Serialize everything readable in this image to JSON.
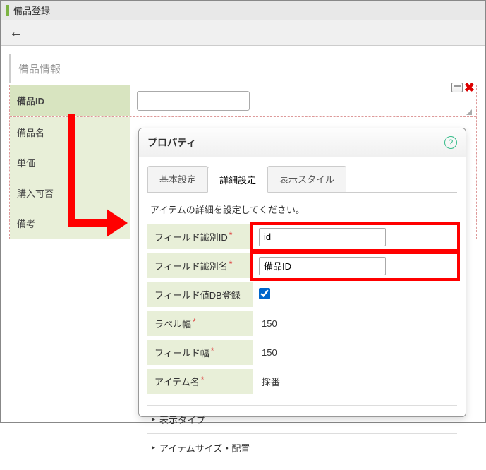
{
  "header": {
    "title": "備品登録"
  },
  "section": {
    "info_label": "備品情報"
  },
  "form": {
    "rows": {
      "id": {
        "label": "備品ID"
      },
      "name": {
        "label": "備品名"
      },
      "price": {
        "label": "単価"
      },
      "purchasable": {
        "label": "購入可否"
      },
      "remarks": {
        "label": "備考"
      }
    }
  },
  "panel": {
    "title": "プロパティ",
    "tabs": {
      "basic": "基本設定",
      "detail": "詳細設定",
      "style": "表示スタイル"
    },
    "description": "アイテムの詳細を設定してください。",
    "props": {
      "field_id": {
        "label": "フィールド識別ID",
        "value": "id"
      },
      "field_name": {
        "label": "フィールド識別名",
        "value": "備品ID"
      },
      "db_reg": {
        "label": "フィールド値DB登録",
        "checked": true
      },
      "label_width": {
        "label": "ラベル幅",
        "value": "150"
      },
      "field_width": {
        "label": "フィールド幅",
        "value": "150"
      },
      "item_name": {
        "label": "アイテム名",
        "value": "採番"
      }
    },
    "accordions": {
      "display_type": "表示タイプ",
      "item_size": "アイテムサイズ・配置"
    }
  }
}
